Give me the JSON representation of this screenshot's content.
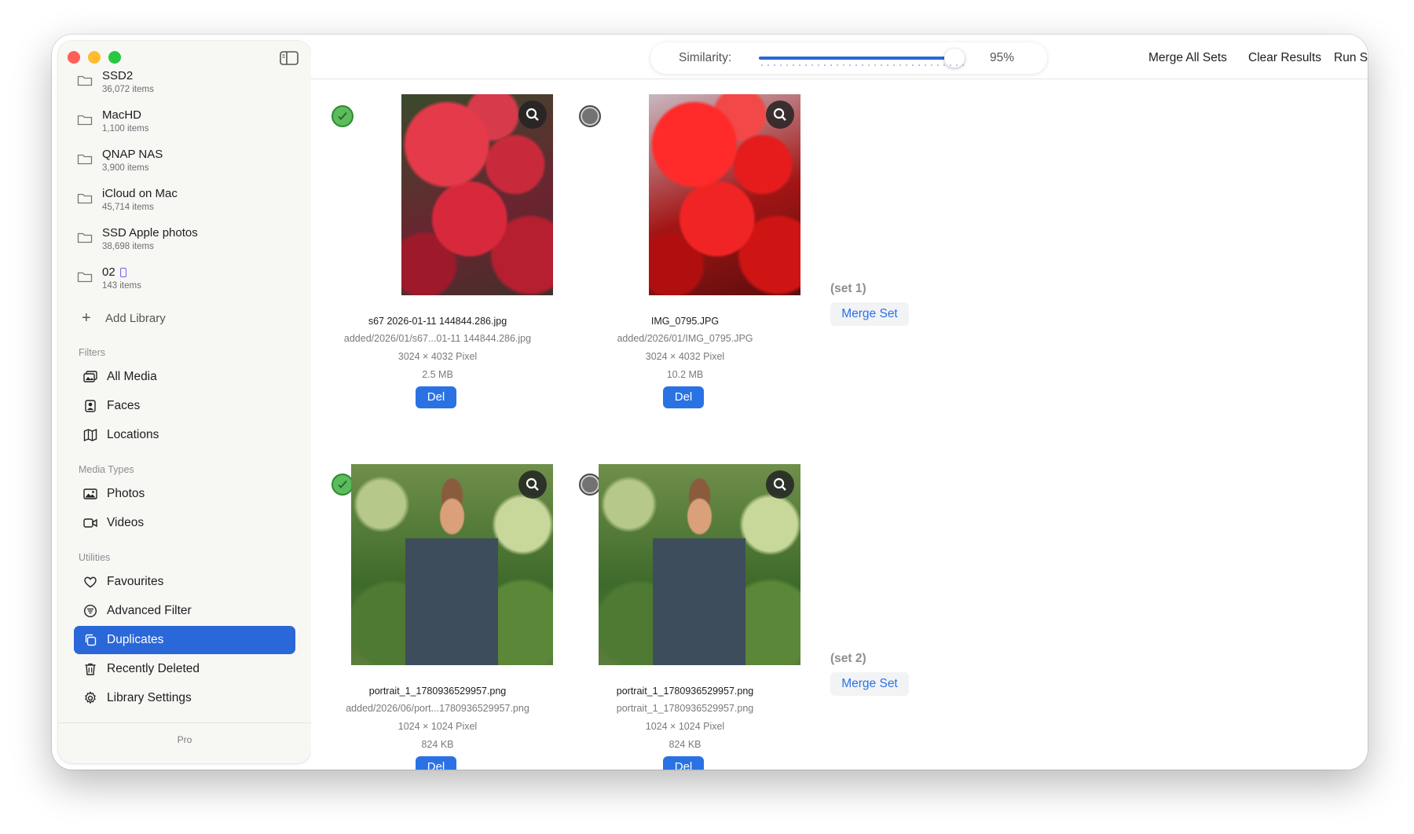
{
  "sidebar": {
    "libraries": [
      {
        "name": "SSD2",
        "count": "36,072 items"
      },
      {
        "name": "MacHD",
        "count": "1,100 items"
      },
      {
        "name": "QNAP NAS",
        "count": "3,900 items"
      },
      {
        "name": "iCloud on Mac",
        "count": "45,714 items"
      },
      {
        "name": "SSD Apple photos",
        "count": "38,698 items"
      },
      {
        "name": "02",
        "count": "143 items"
      }
    ],
    "add_library": "Add Library",
    "filters_header": "Filters",
    "filters": [
      {
        "label": "All Media",
        "icon": "all-media-icon"
      },
      {
        "label": "Faces",
        "icon": "faces-icon"
      },
      {
        "label": "Locations",
        "icon": "map-icon"
      }
    ],
    "media_types_header": "Media Types",
    "media_types": [
      {
        "label": "Photos",
        "icon": "photo-icon"
      },
      {
        "label": "Videos",
        "icon": "video-icon"
      }
    ],
    "utilities_header": "Utilities",
    "utilities": [
      {
        "label": "Favourites",
        "icon": "heart-icon"
      },
      {
        "label": "Advanced Filter",
        "icon": "filter-icon"
      },
      {
        "label": "Duplicates",
        "icon": "duplicate-icon",
        "active": true
      },
      {
        "label": "Recently Deleted",
        "icon": "trash-icon"
      },
      {
        "label": "Library Settings",
        "icon": "gear-icon"
      }
    ],
    "footer": "Pro"
  },
  "toolbar": {
    "similarity_label": "Similarity:",
    "similarity_value": "95%",
    "similarity_fraction": 0.95,
    "merge_all": "Merge All Sets",
    "clear_results": "Clear Results",
    "run_scan": "Run Scan"
  },
  "sets": [
    {
      "label": "(set 1)",
      "merge": "Merge Set",
      "items": [
        {
          "selected": true,
          "filename": "s67 2026-01-11 144844.286.jpg",
          "path": "added/2026/01/s67...01-11 144844.286.jpg",
          "dimensions": "3024 × 4032 Pixel",
          "size": "2.5 MB",
          "del": "Del"
        },
        {
          "selected": false,
          "filename": "IMG_0795.JPG",
          "path": "added/2026/01/IMG_0795.JPG",
          "dimensions": "3024 × 4032 Pixel",
          "size": "10.2 MB",
          "del": "Del"
        }
      ]
    },
    {
      "label": "(set 2)",
      "merge": "Merge Set",
      "items": [
        {
          "selected": true,
          "filename": "portrait_1_1780936529957.png",
          "path": "added/2026/06/port...1780936529957.png",
          "dimensions": "1024 × 1024 Pixel",
          "size": "824 KB",
          "del": "Del"
        },
        {
          "selected": false,
          "filename": "portrait_1_1780936529957.png",
          "path": "portrait_1_1780936529957.png",
          "dimensions": "1024 × 1024 Pixel",
          "size": "824 KB",
          "del": "Del"
        }
      ]
    }
  ],
  "colors": {
    "accent": "#2a67d8",
    "selected_check": "#5cbb5c",
    "del_button": "#2a72e4"
  }
}
